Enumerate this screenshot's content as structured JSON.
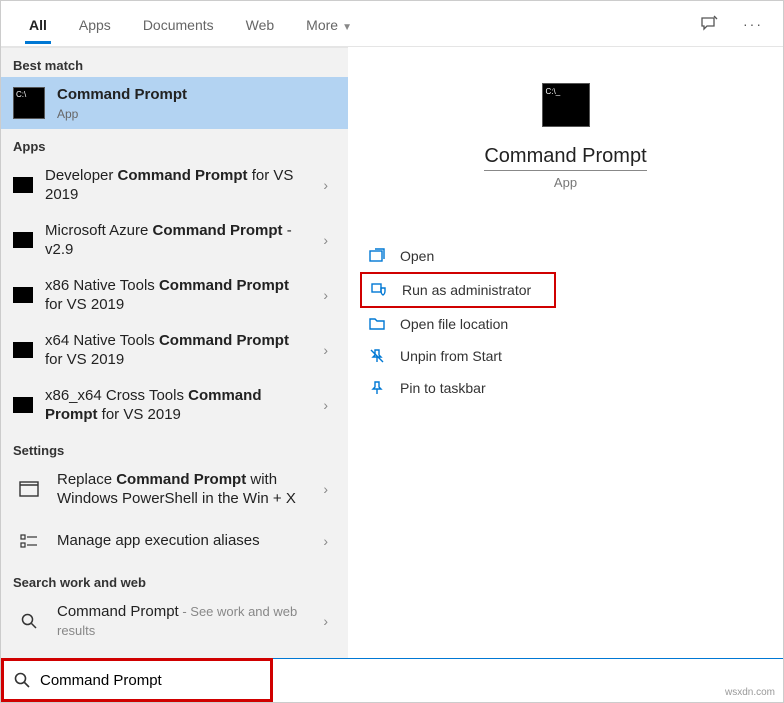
{
  "tabs": {
    "all": "All",
    "apps": "Apps",
    "documents": "Documents",
    "web": "Web",
    "more": "More"
  },
  "sections": {
    "best_match": "Best match",
    "apps": "Apps",
    "settings": "Settings",
    "search_web": "Search work and web"
  },
  "best_match": {
    "title": "Command Prompt",
    "sub": "App"
  },
  "apps_list": [
    {
      "pre": "Developer ",
      "bold": "Command Prompt",
      "post": " for VS 2019"
    },
    {
      "pre": "Microsoft Azure ",
      "bold": "Command Prompt",
      "post": " - v2.9"
    },
    {
      "pre": "x86 Native Tools ",
      "bold": "Command Prompt",
      "post": " for VS 2019"
    },
    {
      "pre": "x64 Native Tools ",
      "bold": "Command Prompt",
      "post": " for VS 2019"
    },
    {
      "pre": "x86_x64 Cross Tools ",
      "bold": "Command Prompt",
      "post": " for VS 2019"
    }
  ],
  "settings_list": [
    {
      "pre": "Replace ",
      "bold": "Command Prompt",
      "post": " with Windows PowerShell in the Win + X"
    },
    {
      "pre": "Manage app execution aliases",
      "bold": "",
      "post": ""
    }
  ],
  "web_list": {
    "title": "Command Prompt",
    "sub": " - See work and web results"
  },
  "preview": {
    "title": "Command Prompt",
    "sub": "App"
  },
  "actions": {
    "open": "Open",
    "run_admin": "Run as administrator",
    "open_loc": "Open file location",
    "unpin_start": "Unpin from Start",
    "pin_taskbar": "Pin to taskbar"
  },
  "search": {
    "value": "Command Prompt"
  },
  "watermark": "wsxdn.com"
}
